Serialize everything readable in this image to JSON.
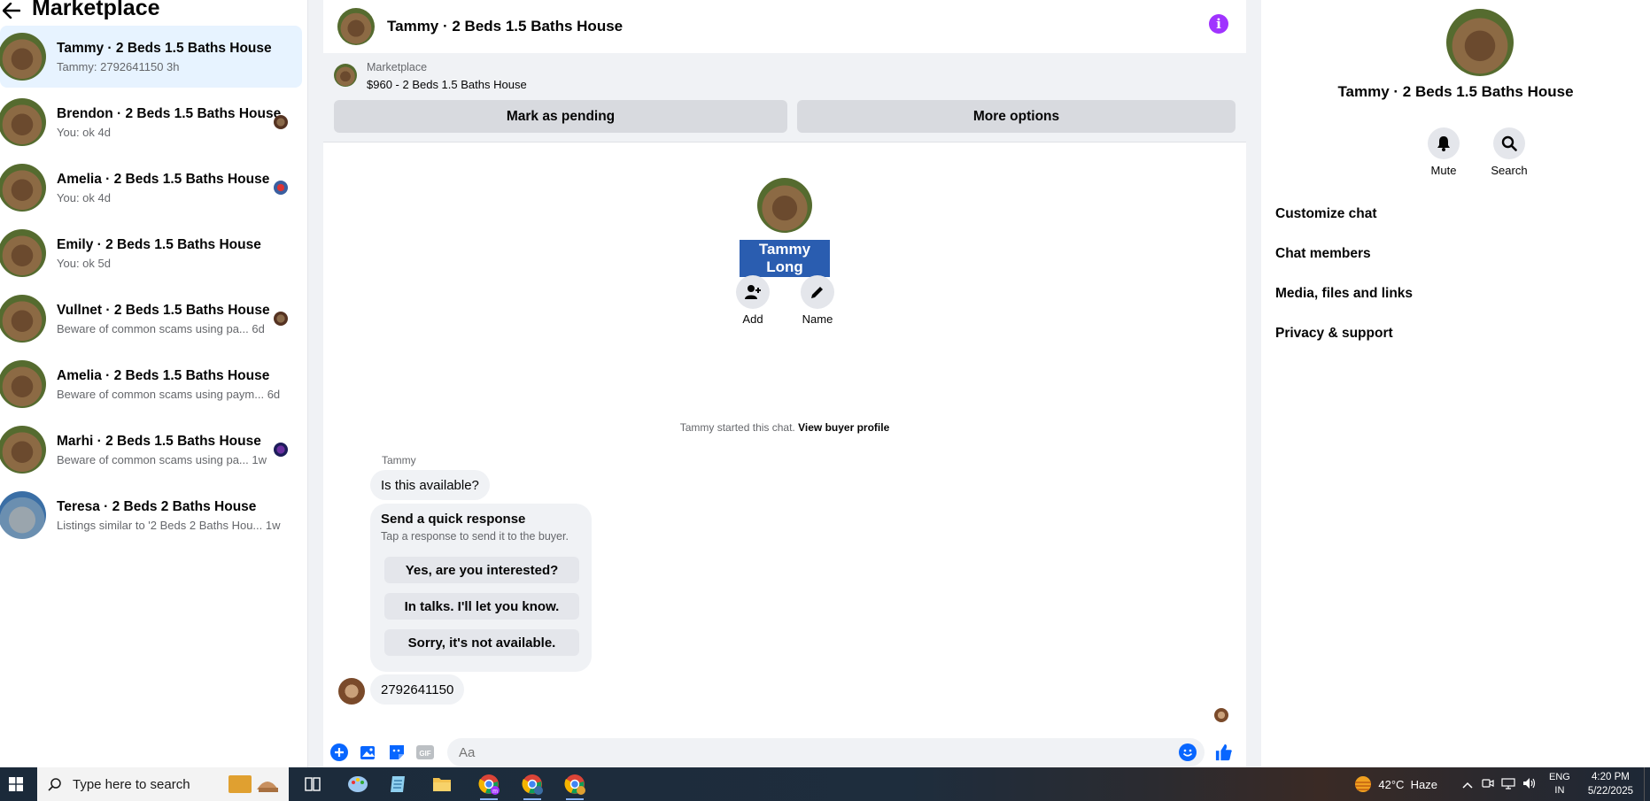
{
  "sidebar": {
    "title": "Marketplace",
    "conversations": [
      {
        "name": "Tammy · 2 Beds 1.5 Baths House",
        "preview": "Tammy: 2792641150 3h",
        "active": true
      },
      {
        "name": "Brendon · 2 Beds 1.5 Baths House",
        "preview": "You: ok 4d"
      },
      {
        "name": "Amelia · 2 Beds 1.5 Baths House",
        "preview": "You: ok 4d"
      },
      {
        "name": "Emily · 2 Beds 1.5 Baths House",
        "preview": "You: ok 5d"
      },
      {
        "name": "Vullnet · 2 Beds 1.5 Baths House",
        "preview": "Beware of common scams using pa... 6d"
      },
      {
        "name": "Amelia · 2 Beds 1.5 Baths House",
        "preview": "Beware of common scams using paym... 6d"
      },
      {
        "name": "Marhi · 2 Beds 1.5 Baths House",
        "preview": "Beware of common scams using pa... 1w"
      },
      {
        "name": "Teresa · 2 Beds 2 Baths House",
        "preview": "Listings similar to '2 Beds 2 Baths Hou... 1w"
      }
    ]
  },
  "chat": {
    "title": "Tammy · 2 Beds 1.5 Baths House",
    "listing": {
      "category": "Marketplace",
      "title": "$960 - 2 Beds 1.5 Baths House",
      "mark_pending": "Mark as pending",
      "more_options": "More options"
    },
    "profile": {
      "name": "Tammy Long",
      "add_label": "Add",
      "name_label": "Name"
    },
    "started_text": "Tammy started this chat.",
    "view_buyer_profile": "View buyer profile",
    "sender_name": "Tammy",
    "first_message": "Is this available?",
    "quick_response": {
      "title": "Send a quick response",
      "subtitle": "Tap a response to send it to the buyer.",
      "options": [
        "Yes, are you interested?",
        "In talks. I'll let you know.",
        "Sorry, it's not available."
      ]
    },
    "last_message": "2792641150",
    "composer_placeholder": "Aa"
  },
  "right_panel": {
    "name": "Tammy · 2 Beds 1.5 Baths House",
    "mute_label": "Mute",
    "search_label": "Search",
    "menu": [
      "Customize chat",
      "Chat members",
      "Media, files and links",
      "Privacy & support"
    ]
  },
  "taskbar": {
    "search_placeholder": "Type here to search",
    "weather": "42°C  Haze",
    "lang_line1": "ENG",
    "lang_line2": "IN",
    "time": "4:20 PM",
    "date": "5/22/2025"
  },
  "colors": {
    "accent": "#0866ff",
    "info": "#a033ff",
    "active_conv": "#e7f3ff"
  }
}
